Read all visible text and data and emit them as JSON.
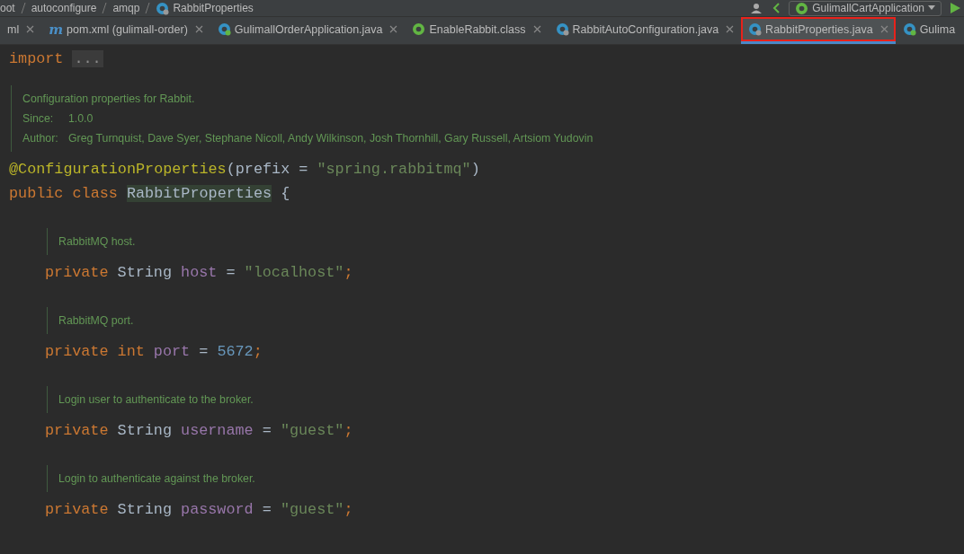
{
  "breadcrumbs": [
    {
      "label": "oot"
    },
    {
      "label": "autoconfigure"
    },
    {
      "label": "amqp"
    },
    {
      "label": "RabbitProperties",
      "kind": "class"
    }
  ],
  "run_config": {
    "label": "GulimallCartApplication"
  },
  "tabs": [
    {
      "label": "ml",
      "kind": "plain",
      "selected": false,
      "highlighted": false,
      "closable": true
    },
    {
      "label": "pom.xml (gulimall-order)",
      "kind": "maven",
      "badge": "m",
      "selected": false,
      "highlighted": false,
      "closable": true
    },
    {
      "label": "GulimallOrderApplication.java",
      "kind": "app",
      "selected": false,
      "highlighted": false,
      "closable": true
    },
    {
      "label": "EnableRabbit.class",
      "kind": "annotation",
      "selected": false,
      "highlighted": false,
      "closable": true
    },
    {
      "label": "RabbitAutoConfiguration.java",
      "kind": "class",
      "selected": false,
      "highlighted": false,
      "closable": true
    },
    {
      "label": "RabbitProperties.java",
      "kind": "class",
      "selected": true,
      "highlighted": true,
      "closable": true
    },
    {
      "label": "Gulima",
      "kind": "app",
      "selected": false,
      "highlighted": false,
      "closable": false
    }
  ],
  "editor": [
    {
      "kind": "code",
      "tokens": [
        {
          "kind": "keyword",
          "s": "import"
        },
        {
          "kind": "folded",
          "s": "..."
        }
      ]
    },
    {
      "kind": "blank"
    },
    {
      "kind": "doc",
      "lines": [
        {
          "text": "Configuration properties for Rabbit."
        },
        {
          "label": "Since:",
          "text": "1.0.0"
        },
        {
          "label": "Author:",
          "text": "Greg Turnquist, Dave Syer, Stephane Nicoll, Andy Wilkinson, Josh Thornhill, Gary Russell, Artsiom Yudovin"
        }
      ]
    },
    {
      "kind": "code",
      "tokens": [
        {
          "kind": "annotation",
          "s": "@ConfigurationProperties"
        },
        {
          "kind": "plain",
          "s": "(prefix = "
        },
        {
          "kind": "string",
          "s": "\"spring.rabbitmq\""
        },
        {
          "kind": "plain",
          "s": ")"
        }
      ]
    },
    {
      "kind": "code",
      "tokens": [
        {
          "kind": "keyword",
          "s": "public class "
        },
        {
          "kind": "classname",
          "s": "RabbitProperties"
        },
        {
          "kind": "plain",
          "s": " {"
        }
      ],
      "children": [
        {
          "kind": "blank"
        },
        {
          "kind": "doc",
          "lines": [
            {
              "text": "RabbitMQ host."
            }
          ]
        },
        {
          "kind": "code",
          "tokens": [
            {
              "kind": "keyword",
              "s": "private "
            },
            {
              "kind": "plain",
              "s": "String "
            },
            {
              "kind": "field",
              "s": "host"
            },
            {
              "kind": "plain",
              "s": " = "
            },
            {
              "kind": "string",
              "s": "\"localhost\""
            },
            {
              "kind": "keyword",
              "s": ";"
            }
          ]
        },
        {
          "kind": "blank"
        },
        {
          "kind": "doc",
          "lines": [
            {
              "text": "RabbitMQ port."
            }
          ]
        },
        {
          "kind": "code",
          "tokens": [
            {
              "kind": "keyword",
              "s": "private int "
            },
            {
              "kind": "field",
              "s": "port"
            },
            {
              "kind": "plain",
              "s": " = "
            },
            {
              "kind": "number",
              "s": "5672"
            },
            {
              "kind": "keyword",
              "s": ";"
            }
          ]
        },
        {
          "kind": "blank"
        },
        {
          "kind": "doc",
          "lines": [
            {
              "text": "Login user to authenticate to the broker."
            }
          ]
        },
        {
          "kind": "code",
          "tokens": [
            {
              "kind": "keyword",
              "s": "private "
            },
            {
              "kind": "plain",
              "s": "String "
            },
            {
              "kind": "field",
              "s": "username"
            },
            {
              "kind": "plain",
              "s": " = "
            },
            {
              "kind": "string",
              "s": "\"guest\""
            },
            {
              "kind": "keyword",
              "s": ";"
            }
          ]
        },
        {
          "kind": "blank"
        },
        {
          "kind": "doc",
          "lines": [
            {
              "text": "Login to authenticate against the broker."
            }
          ]
        },
        {
          "kind": "code",
          "tokens": [
            {
              "kind": "keyword",
              "s": "private "
            },
            {
              "kind": "plain",
              "s": "String "
            },
            {
              "kind": "field",
              "s": "password"
            },
            {
              "kind": "plain",
              "s": " = "
            },
            {
              "kind": "string",
              "s": "\"guest\""
            },
            {
              "kind": "keyword",
              "s": ";"
            }
          ]
        }
      ]
    }
  ]
}
